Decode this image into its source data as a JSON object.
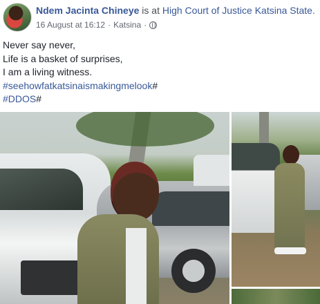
{
  "post": {
    "author": "Ndem Jacinta Chineye",
    "verb": "is at",
    "place": "High Court of Justice Katsina State.",
    "date": "16 August at 16:12",
    "separator": "·",
    "location": "Katsina",
    "privacy_icon": "globe-icon",
    "lines": [
      "Never say never,",
      "Life is a basket of surprises,",
      "I am a living witness."
    ],
    "hashtags": [
      {
        "tag": "#seehowfatkatsinaismakingmelook",
        "suffix": "#"
      },
      {
        "tag": "#DDOS",
        "suffix": "#"
      }
    ]
  },
  "colors": {
    "link": "#385898",
    "text": "#1d2129",
    "meta": "#616770"
  }
}
